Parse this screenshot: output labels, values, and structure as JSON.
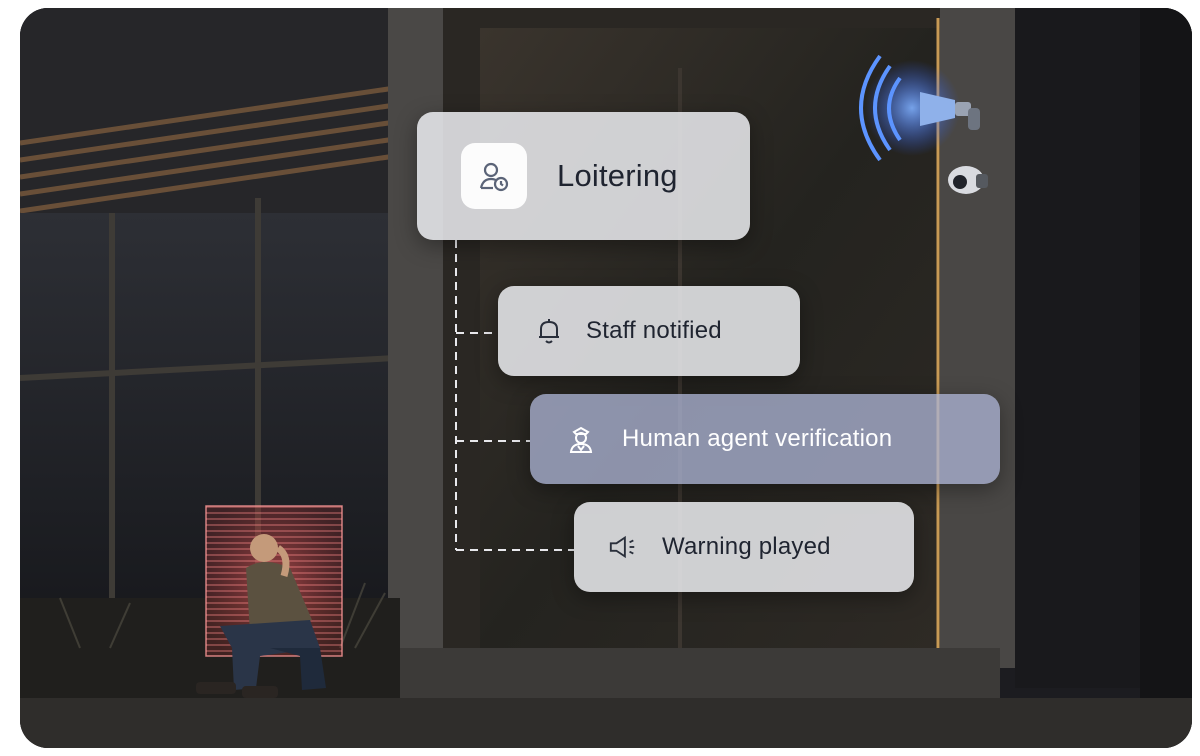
{
  "alert": {
    "title": "Loitering",
    "icon": "person-clock-icon"
  },
  "steps": [
    {
      "label": "Staff notified",
      "icon": "bell-icon"
    },
    {
      "label": "Human agent verification",
      "icon": "guard-icon"
    },
    {
      "label": "Warning played",
      "icon": "speaker-icon"
    }
  ],
  "colors": {
    "card_bg": "#ECEDF1",
    "highlight_card_bg": "#AAB2D2",
    "connector": "#E8E8EC",
    "icon_stroke": "#5B6478",
    "speaker_glow": "#3E7BFF",
    "presence_box": "#E04848"
  }
}
